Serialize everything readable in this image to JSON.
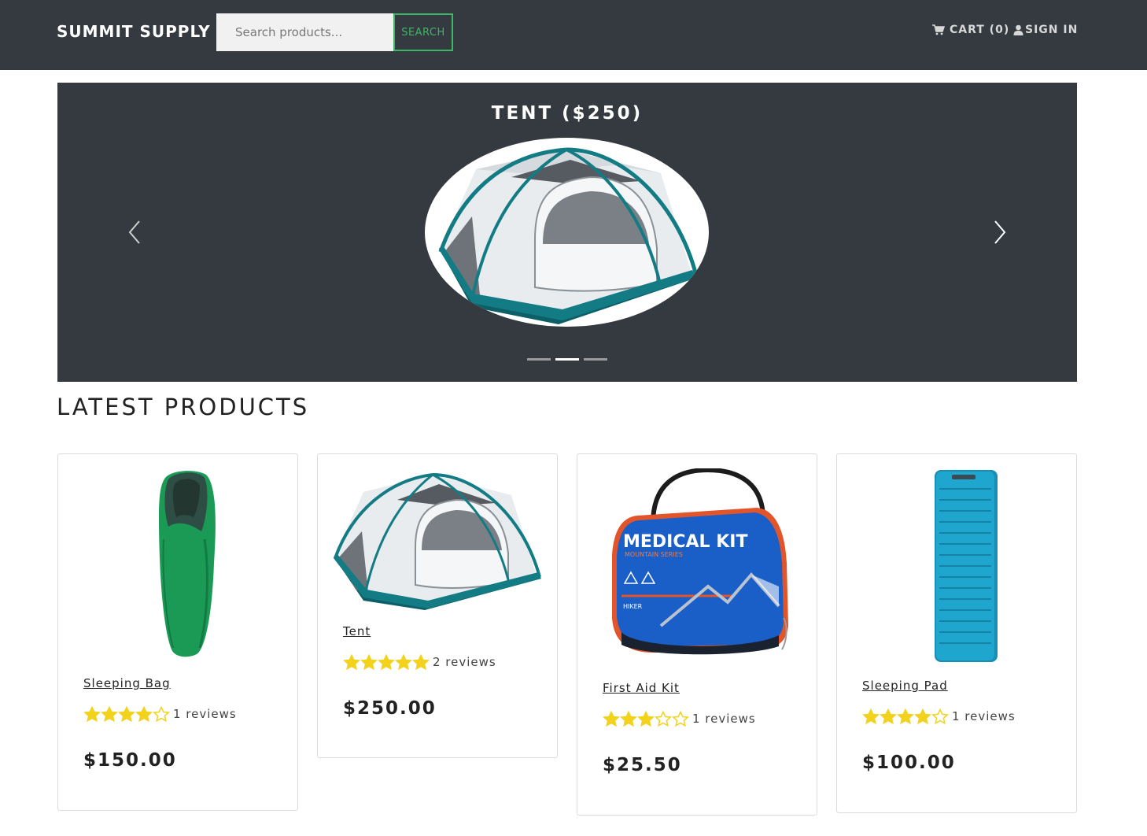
{
  "navbar": {
    "brand": "SUMMIT SUPPLY",
    "search_placeholder": "Search products...",
    "search_button": "SEARCH",
    "cart_label": "CART (0)",
    "signin_label": "SIGN IN"
  },
  "carousel": {
    "title": "TENT ($250)",
    "active_index": 1,
    "slide_count": 3
  },
  "latest": {
    "heading": "LATEST PRODUCTS",
    "products": [
      {
        "name": "Sleeping Bag",
        "rating": 4,
        "reviews": "1 reviews",
        "price": "$150.00"
      },
      {
        "name": "Tent",
        "rating": 5,
        "reviews": "2 reviews",
        "price": "$250.00"
      },
      {
        "name": "First Aid Kit",
        "rating": 3,
        "reviews": "1 reviews",
        "price": "$25.50"
      },
      {
        "name": "Sleeping Pad",
        "rating": 4,
        "reviews": "1 reviews",
        "price": "$100.00"
      }
    ]
  },
  "images": {
    "medical_kit_line1": "MEDICAL KIT",
    "medical_kit_line2": "MOUNTAIN SERIES",
    "medical_kit_hiker": "HIKER"
  },
  "colors": {
    "navbar_bg": "#343a40",
    "search_accent": "#3fb566",
    "star": "#f2d21c",
    "tent_teal": "#127b84",
    "sleeping_bag_green": "#1a9a55",
    "medical_kit_blue": "#1a5fc8",
    "sleeping_pad_blue": "#1ea6cf"
  }
}
